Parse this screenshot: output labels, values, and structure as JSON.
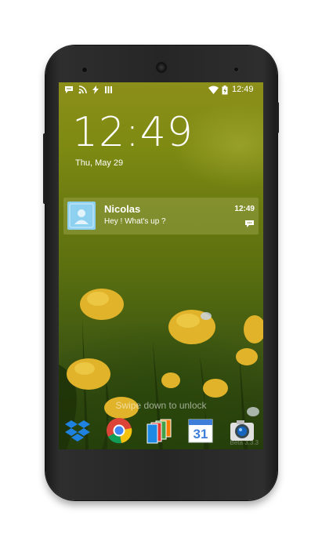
{
  "status_bar": {
    "time": "12:49"
  },
  "lock_screen": {
    "clock": "12:49",
    "date": "Thu, May 29",
    "swipe_hint": "Swipe down to unlock",
    "build_label": "Beta 3.3.3"
  },
  "notification": {
    "sender": "Nicolas",
    "message": "Hey ! What's up ?",
    "time": "12:49"
  },
  "dock": [
    {
      "name": "dropbox",
      "icon": "dropbox-icon"
    },
    {
      "name": "chrome",
      "icon": "chrome-icon"
    },
    {
      "name": "gallery",
      "icon": "gallery-icon"
    },
    {
      "name": "calendar",
      "icon": "calendar-icon",
      "badge": "31"
    },
    {
      "name": "camera",
      "icon": "camera-icon"
    }
  ]
}
